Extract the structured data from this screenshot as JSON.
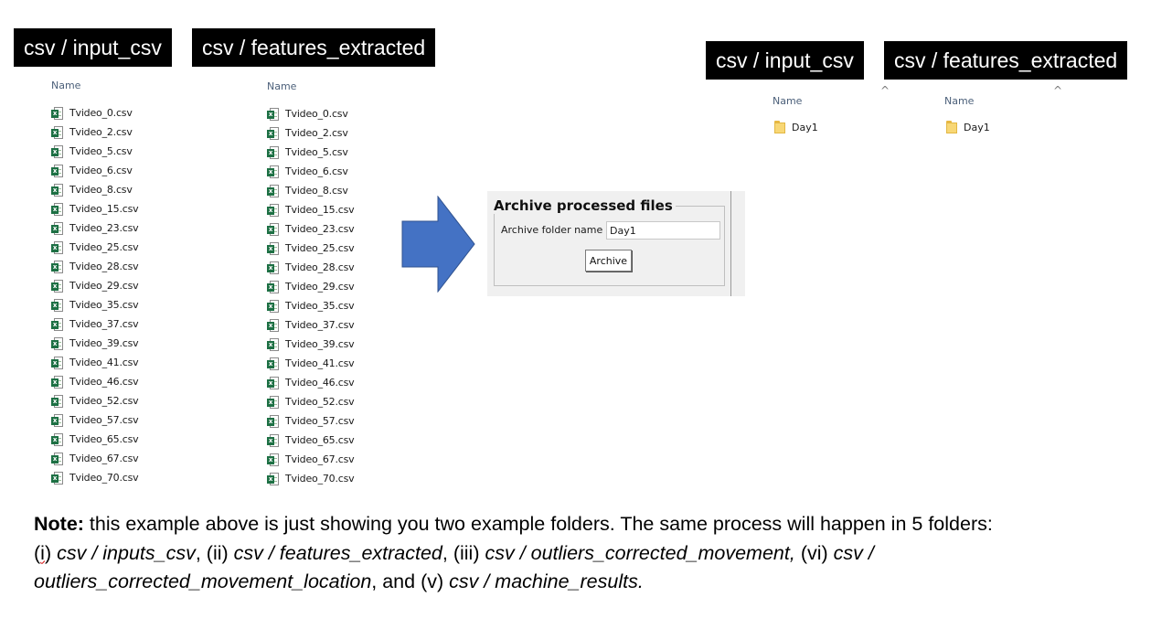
{
  "labels": {
    "left_input": "csv / input_csv",
    "left_features": "csv / features_extracted",
    "right_input": "csv / input_csv",
    "right_features": "csv / features_extracted"
  },
  "column_header": "Name",
  "files_input": [
    "Tvideo_0.csv",
    "Tvideo_2.csv",
    "Tvideo_5.csv",
    "Tvideo_6.csv",
    "Tvideo_8.csv",
    "Tvideo_15.csv",
    "Tvideo_23.csv",
    "Tvideo_25.csv",
    "Tvideo_28.csv",
    "Tvideo_29.csv",
    "Tvideo_35.csv",
    "Tvideo_37.csv",
    "Tvideo_39.csv",
    "Tvideo_41.csv",
    "Tvideo_46.csv",
    "Tvideo_52.csv",
    "Tvideo_57.csv",
    "Tvideo_65.csv",
    "Tvideo_67.csv",
    "Tvideo_70.csv"
  ],
  "files_features": [
    "Tvideo_0.csv",
    "Tvideo_2.csv",
    "Tvideo_5.csv",
    "Tvideo_6.csv",
    "Tvideo_8.csv",
    "Tvideo_15.csv",
    "Tvideo_23.csv",
    "Tvideo_25.csv",
    "Tvideo_28.csv",
    "Tvideo_29.csv",
    "Tvideo_35.csv",
    "Tvideo_37.csv",
    "Tvideo_39.csv",
    "Tvideo_41.csv",
    "Tvideo_46.csv",
    "Tvideo_52.csv",
    "Tvideo_57.csv",
    "Tvideo_65.csv",
    "Tvideo_67.csv",
    "Tvideo_70.csv"
  ],
  "file_icon": "excel-file-icon",
  "folder_icon": "folder-icon",
  "right_folders": {
    "input_header": "Name",
    "features_header": "Name",
    "input_folder": "Day1",
    "features_folder": "Day1"
  },
  "arrow": {
    "icon": "right-arrow-icon",
    "color": "#4472c4",
    "border": "#2f528f"
  },
  "panel": {
    "title": "Archive processed files",
    "field_label": "Archive folder name",
    "field_value": "Day1",
    "button_label": "Archive"
  },
  "note": {
    "bold": "Note:",
    "t1": " this example above is just showing you two example folders. The same process will happen in 5 folders:",
    "t2a": "(",
    "t2b": "i",
    "t2c": ") ",
    "i1": "csv / inputs_csv",
    "t3": ", (ii) ",
    "i2": "csv / features_extracted",
    "t4": ", (iii) ",
    "i3": "csv / outliers_corrected_movement,",
    "t5": " (vi) ",
    "i4a": "csv /",
    "i4b": "outliers_corrected_movement_location",
    "t6": ", and (v) ",
    "i5": "csv / machine_results."
  }
}
